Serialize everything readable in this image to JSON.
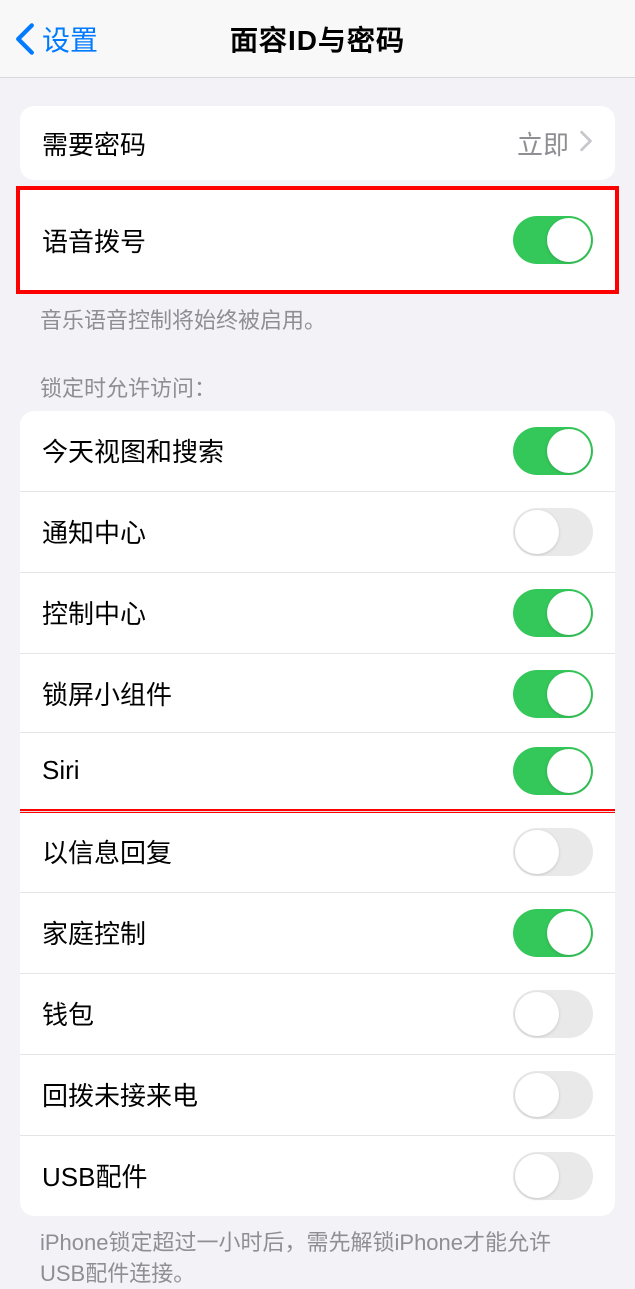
{
  "header": {
    "back_label": "设置",
    "title": "面容ID与密码"
  },
  "require_passcode": {
    "label": "需要密码",
    "value": "立即"
  },
  "voice_dial": {
    "label": "语音拨号",
    "footer": "音乐语音控制将始终被启用。"
  },
  "locked_access": {
    "header": "锁定时允许访问：",
    "items": [
      {
        "label": "今天视图和搜索",
        "on": true
      },
      {
        "label": "通知中心",
        "on": false
      },
      {
        "label": "控制中心",
        "on": true
      },
      {
        "label": "锁屏小组件",
        "on": true
      },
      {
        "label": "Siri",
        "on": true
      },
      {
        "label": "以信息回复",
        "on": false
      },
      {
        "label": "家庭控制",
        "on": true
      },
      {
        "label": "钱包",
        "on": false
      },
      {
        "label": "回拨未接来电",
        "on": false
      },
      {
        "label": "USB配件",
        "on": false
      }
    ],
    "footer": "iPhone锁定超过一小时后，需先解锁iPhone才能允许USB配件连接。"
  }
}
